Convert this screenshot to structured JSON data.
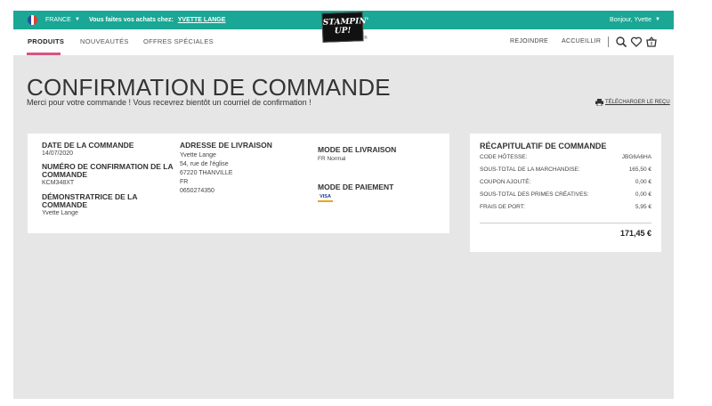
{
  "topbar": {
    "country": "FRANCE",
    "shop_label": "Vous faites vos achats chez:",
    "shop_name": "YVETTE LANGE",
    "greeting": "Bonjour, Yvette",
    "flag_colors": [
      "#2a4a9c",
      "#ffffff",
      "#e23b3b"
    ],
    "bar_color": "#1aa795"
  },
  "logo": {
    "line1": "STAMPIN'",
    "line2": "UP!",
    "mark": "®"
  },
  "nav": {
    "left": [
      "PRODUITS",
      "NOUVEAUTÉS",
      "OFFRES SPÉCIALES"
    ],
    "active_index": 0,
    "right": [
      "REJOINDRE",
      "ACCUEILLIR"
    ],
    "icons": [
      "search-icon",
      "heart-icon",
      "basket-icon"
    ],
    "accent_color": "#d85485"
  },
  "page": {
    "title": "CONFIRMATION DE COMMANDE",
    "subtitle": "Merci pour votre commande ! Vous recevrez bientôt un courriel de confirmation !",
    "download_label": "TÉLÉCHARGER LE REÇU"
  },
  "order": {
    "date_label": "DATE DE LA COMMANDE",
    "date_value": "14/07/2020",
    "number_label": "NUMÉRO DE CONFIRMATION DE LA COMMANDE",
    "number_value": "KCM348XT",
    "demo_label": "DÉMONSTRATRICE DE LA COMMANDE",
    "demo_value": "Yvette Lange",
    "address_label": "ADRESSE DE LIVRAISON",
    "address_lines": [
      "Yvette Lange",
      "54, rue de l'église",
      "67220 THANVILLE",
      "FR",
      "0650274350"
    ],
    "delivery_label": "MODE DE LIVRAISON",
    "delivery_value": "FR Normal",
    "payment_label": "MODE DE PAIEMENT",
    "payment_card": "VISA"
  },
  "summary": {
    "title": "RÉCAPITULATIF DE COMMANDE",
    "rows": [
      {
        "label": "CODE HÔTESSE:",
        "value": "JBG6A6HA"
      },
      {
        "label": "SOUS-TOTAL DE LA MARCHANDISE:",
        "value": "165,50 €"
      },
      {
        "label": "COUPON AJOUTÉ:",
        "value": "0,00 €"
      },
      {
        "label": "SOUS-TOTAL DES PRIMES CRÉATIVES:",
        "value": "0,00 €"
      },
      {
        "label": "FRAIS DE PORT:",
        "value": "5,95 €"
      }
    ],
    "total": "171,45 €"
  }
}
